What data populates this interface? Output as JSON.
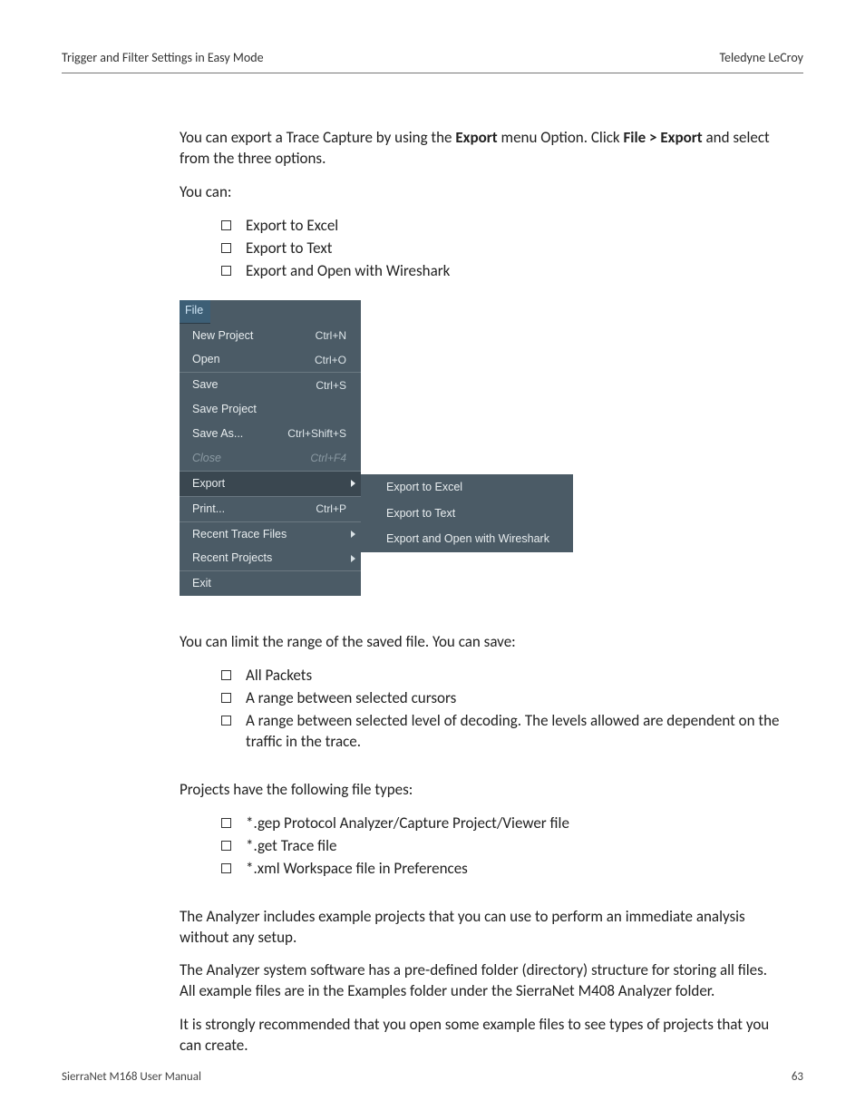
{
  "header": {
    "left": "Trigger and Filter Settings in Easy Mode",
    "right": "Teledyne LeCroy"
  },
  "para1_pre": "You can export a Trace Capture by using the ",
  "para1_b1": "Export",
  "para1_mid": " menu Option. Click ",
  "para1_b2": "File > Export",
  "para1_post": " and select from the three options.",
  "para2": "You can:",
  "list1": [
    "Export to Excel",
    "Export to Text",
    "Export and Open with Wireshark"
  ],
  "menu": {
    "file_label": "File",
    "items": [
      {
        "label": "New Project",
        "shortcut": "Ctrl+N",
        "sep": false,
        "arrow": false,
        "disabled": false,
        "highlight": false
      },
      {
        "label": "Open",
        "shortcut": "Ctrl+O",
        "sep": false,
        "arrow": false,
        "disabled": false,
        "highlight": false
      },
      {
        "label": "Save",
        "shortcut": "Ctrl+S",
        "sep": true,
        "arrow": false,
        "disabled": false,
        "highlight": false
      },
      {
        "label": "Save Project",
        "shortcut": "",
        "sep": false,
        "arrow": false,
        "disabled": false,
        "highlight": false
      },
      {
        "label": "Save As...",
        "shortcut": "Ctrl+Shift+S",
        "sep": false,
        "arrow": false,
        "disabled": false,
        "highlight": false
      },
      {
        "label": "Close",
        "shortcut": "Ctrl+F4",
        "sep": false,
        "arrow": false,
        "disabled": true,
        "highlight": false
      },
      {
        "label": "Export",
        "shortcut": "",
        "sep": true,
        "arrow": true,
        "disabled": false,
        "highlight": true
      },
      {
        "label": "Print...",
        "shortcut": "Ctrl+P",
        "sep": true,
        "arrow": false,
        "disabled": false,
        "highlight": false
      },
      {
        "label": "Recent Trace Files",
        "shortcut": "",
        "sep": true,
        "arrow": true,
        "disabled": false,
        "highlight": false
      },
      {
        "label": "Recent Projects",
        "shortcut": "",
        "sep": false,
        "arrow": true,
        "disabled": false,
        "highlight": false
      },
      {
        "label": "Exit",
        "shortcut": "",
        "sep": true,
        "arrow": false,
        "disabled": false,
        "highlight": false
      }
    ],
    "submenu": [
      "Export to Excel",
      "Export to Text",
      "Export and Open with Wireshark"
    ]
  },
  "para3": "You can limit the range of the saved file. You can save:",
  "list2": [
    "All Packets",
    "A range between selected cursors",
    "A range between selected level of decoding. The levels allowed are dependent on the traffic in the trace."
  ],
  "para4": "Projects have the following file types:",
  "list3": [
    "*.gep Protocol Analyzer/Capture Project/Viewer file",
    "*.get Trace file",
    "*.xml Workspace file in Preferences"
  ],
  "para5": "The Analyzer includes example projects that you can use to perform an immediate analysis without any setup.",
  "para6": "The Analyzer system software has a pre-defined folder (directory) structure for storing all files. All example files are in the Examples folder under the SierraNet M408 Analyzer folder.",
  "para7": "It is strongly recommended that you open some example files to see types of projects that you can create.",
  "footer": {
    "left": "SierraNet M168 User Manual",
    "right": "63"
  }
}
